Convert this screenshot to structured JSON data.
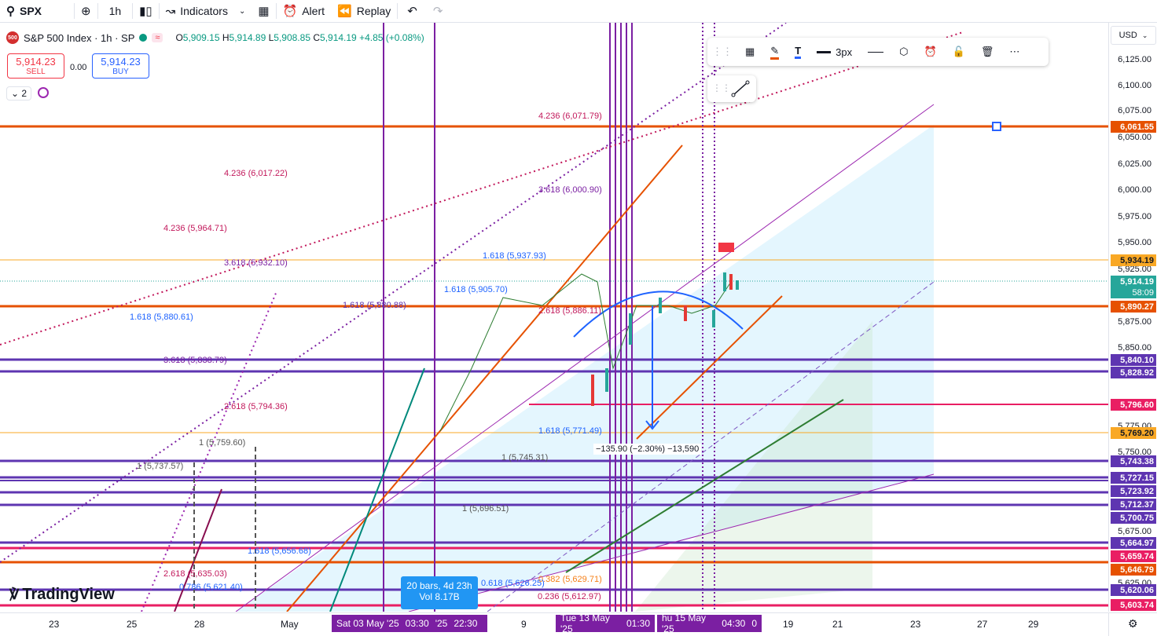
{
  "toolbar": {
    "symbol": "SPX",
    "interval": "1h",
    "indicators_label": "Indicators",
    "alert_label": "Alert",
    "replay_label": "Replay"
  },
  "legend": {
    "title": "S&P 500 Index · 1h · SP",
    "logo_text": "500",
    "open_k": "O",
    "open": "5,909.15",
    "high_k": "H",
    "high": "5,914.89",
    "low_k": "L",
    "low": "5,908.85",
    "close_k": "C",
    "close": "5,914.19",
    "change": "+4.85 (+0.08%)",
    "sell_price": "5,914.23",
    "sell_label": "SELL",
    "buy_price": "5,914.23",
    "buy_label": "BUY",
    "spread": "0.00",
    "indicator_count": "2"
  },
  "drawing_toolbar": {
    "width_label": "3px"
  },
  "price_axis": {
    "currency": "USD",
    "ticks": [
      "6,125.00",
      "6,100.00",
      "6,075.00",
      "6,050.00",
      "6,025.00",
      "6,000.00",
      "5,975.00",
      "5,950.00",
      "5,925.00",
      "5,875.00",
      "5,850.00",
      "5,775.00",
      "5,750.00",
      "5,675.00",
      "5,625.00"
    ],
    "labels": [
      {
        "v": "6,061.55",
        "color": "#e65100"
      },
      {
        "v": "5,934.19",
        "color": "#f9a825"
      },
      {
        "v": "5,914.19",
        "color": "#26a69a"
      },
      {
        "v": "58:09",
        "color": "#26a69a"
      },
      {
        "v": "5,890.27",
        "color": "#e65100"
      },
      {
        "v": "5,840.10",
        "color": "#5e35b1"
      },
      {
        "v": "5,828.92",
        "color": "#5e35b1"
      },
      {
        "v": "5,796.60",
        "color": "#e91e63"
      },
      {
        "v": "5,769.20",
        "color": "#f9a825"
      },
      {
        "v": "5,743.38",
        "color": "#5e35b1"
      },
      {
        "v": "5,727.15",
        "color": "#5e35b1"
      },
      {
        "v": "5,723.92",
        "color": "#5e35b1"
      },
      {
        "v": "5,712.37",
        "color": "#5e35b1"
      },
      {
        "v": "5,700.75",
        "color": "#5e35b1"
      },
      {
        "v": "5,664.97",
        "color": "#5e35b1"
      },
      {
        "v": "5,659.74",
        "color": "#e91e63"
      },
      {
        "v": "5,646.79",
        "color": "#e65100"
      },
      {
        "v": "5,620.06",
        "color": "#5e35b1"
      },
      {
        "v": "5,603.74",
        "color": "#e91e63"
      }
    ]
  },
  "time_axis": {
    "ticks": [
      "23",
      "25",
      "28",
      "May",
      "9",
      "19",
      "21",
      "23",
      "27",
      "29"
    ],
    "pill_1": "Sat 03 May '25",
    "pill_1b": "03:30",
    "pill_1c": "'25",
    "pill_1d": "22:30",
    "pill_2": "Tue 13 May '25",
    "pill_2b": "01:30",
    "pill_3": "hu 15 May '25",
    "pill_3b": "04:30",
    "pill_3c": "0"
  },
  "annotations": {
    "fib_4236_a": "4.236 (6,071.79)",
    "fib_4236_b": "4.236 (6,017.22)",
    "fib_4236_c": "4.236 (5,964.71)",
    "fib_3618_a": "3.618 (6,000.90)",
    "fib_3618_b": "3.618 (5,932.10)",
    "fib_3618_c": "3.618 (5,838.79)",
    "fib_1618_a": "1.618 (5,937.93)",
    "fib_1618_b": "1.618 (5,880.61)",
    "fib_1618_c": "1.618 (5,880.88)",
    "fib_1618_d": "1.618 (5,905.70)",
    "fib_1618_e": "1.618 (5,771.49)",
    "fib_1618_f": "1.618 (5,656.68)",
    "fib_2618_a": "2.618 (5,886.11)",
    "fib_2618_b": "2.618 (5,794.36)",
    "fib_2618_c": "2.618 (5,635.03)",
    "fib_1_a": "1 (5,759.60)",
    "fib_1_b": "1 (5,737.57)",
    "fib_1_c": "1 (5,745.31)",
    "fib_1_d": "1 (5,696.51)",
    "fib_0786": "0.786 (5,621.40)",
    "fib_0236": "0.236 (5,612.97)",
    "fib_0382": "0.382 (5,629.71)",
    "fib_0618": "0.618 (5,626.25)",
    "measure": "−135.90 (−2.30%) −13,590",
    "bars_1": "20 bars, 4d 23h",
    "bars_2": "Vol 8.17B",
    "brand": "TradingView"
  }
}
